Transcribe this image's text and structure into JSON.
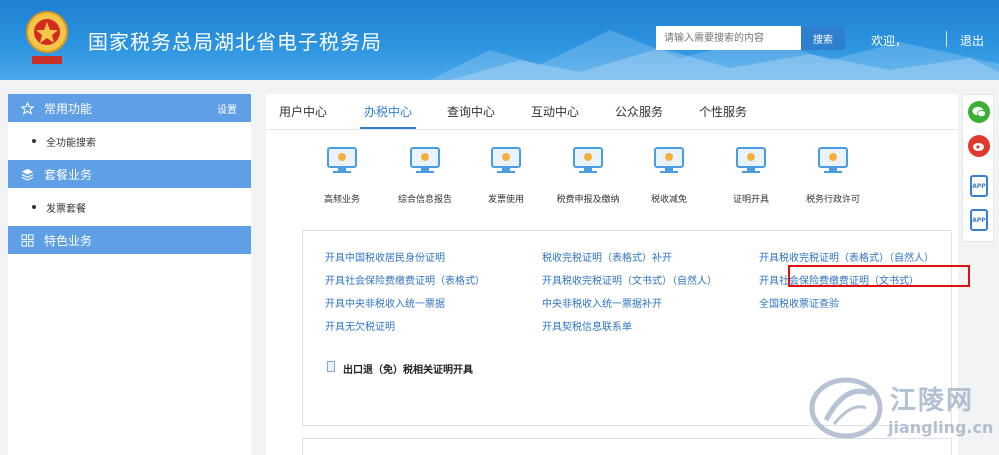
{
  "header": {
    "title": "国家税务总局湖北省电子税务局",
    "search_placeholder": "请输入需要搜索的内容",
    "search_button": "搜索",
    "welcome": "欢迎，",
    "logout": "退出"
  },
  "sidebar": {
    "sections": [
      {
        "label": "常用功能",
        "settings": "设置",
        "items": [
          "全功能搜索"
        ]
      },
      {
        "label": "套餐业务",
        "items": [
          "发票套餐"
        ]
      },
      {
        "label": "特色业务",
        "items": []
      }
    ]
  },
  "tabs": [
    "用户中心",
    "办税中心",
    "查询中心",
    "互动中心",
    "公众服务",
    "个性服务"
  ],
  "active_tab": "办税中心",
  "functions": [
    "高频业务",
    "综合信息报告",
    "发票使用",
    "税费申报及缴纳",
    "税收减免",
    "证明开具",
    "税务行政许可"
  ],
  "links": {
    "col1": [
      "开具中国税收居民身份证明",
      "开具社会保险费缴费证明（表格式）",
      "开具中央非税收入统一票据",
      "开具无欠税证明"
    ],
    "col2": [
      "税收完税证明（表格式）补开",
      "开具税收完税证明（文书式）（自然人）",
      "中央非税收入统一票据补开",
      "开具契税信息联系单"
    ],
    "col3": [
      "开具税收完税证明（表格式）（自然人）",
      "开具社会保险费缴费证明（文书式）",
      "全国税收票证查验"
    ]
  },
  "highlighted_link": "开具社会保险费缴费证明（文书式）",
  "export_label": "出口退（免）税相关证明开具",
  "watermark": {
    "name": "江陵网",
    "url": "jiangling.cn"
  },
  "colors": {
    "header": "#2b93e0",
    "accent": "#2f7fd0",
    "sidebar_head": "#5f9fe6",
    "highlight": "#e01010",
    "link": "#2f74c4"
  }
}
